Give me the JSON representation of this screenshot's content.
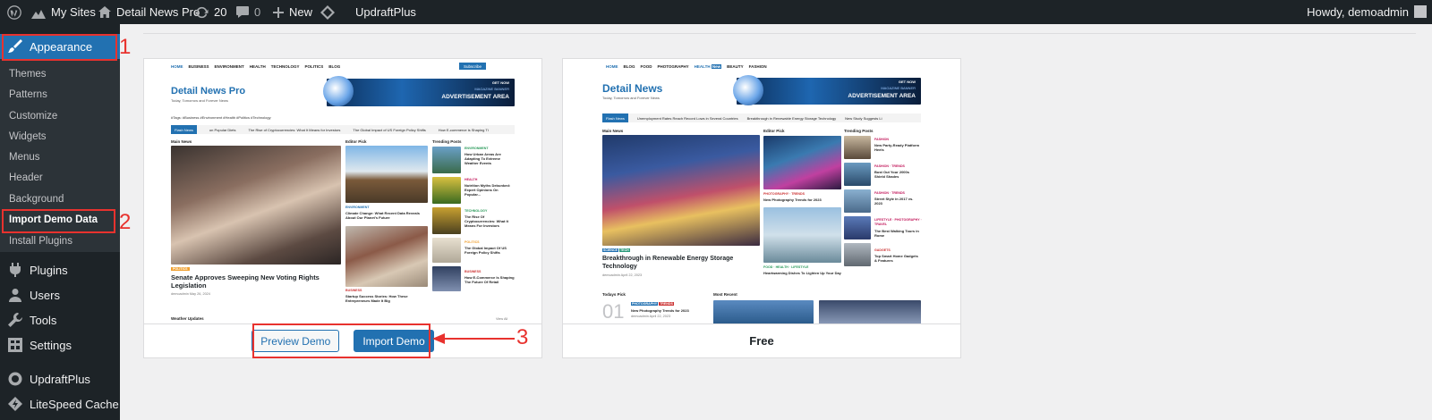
{
  "adminbar": {
    "my_sites": "My Sites",
    "site_name": "Detail News Pro",
    "updates": "20",
    "comments": "0",
    "new": "New",
    "plugin": "UpdraftPlus",
    "howdy": "Howdy, demoadmin"
  },
  "sidebar": {
    "appearance": "Appearance",
    "submenu": [
      "Themes",
      "Patterns",
      "Customize",
      "Widgets",
      "Menus",
      "Header",
      "Background",
      "Import Demo Data",
      "Install Plugins"
    ],
    "plugins": "Plugins",
    "users": "Users",
    "tools": "Tools",
    "settings": "Settings",
    "updraftplus": "UpdraftPlus",
    "litespeed": "LiteSpeed Cache"
  },
  "demos": [
    {
      "site_title": "Detail News Pro",
      "tagline": "Today, Tomorrow and Forever News",
      "nav": [
        "HOME",
        "BUSINESS",
        "ENVIRONMENT",
        "HEALTH",
        "TECHNOLOGY",
        "POLITICS",
        "BLOG"
      ],
      "subscribe": "Subscribe",
      "ad_top": "GET NOW",
      "ad_sub": "MAGAZINE BANNER",
      "ad_text": "ADVERTISEMENT AREA",
      "tags": "#Tags: #Business #Environment #Health #Politics #Technology",
      "flash_label": "Flash News",
      "flash_items": [
        "on Popular Diets",
        "The Rise of Cryptocurrencies: What It Means for Investors",
        "The Global Impact of US Foreign Policy Shifts",
        "How E-commerce is Shaping Ti"
      ],
      "main_news": "Main News",
      "editor_pick": "Editor Pick",
      "trending": "Trending Posts",
      "main_cat": "POLITICS",
      "main_title": "Senate Approves Sweeping New Voting Rights Legislation",
      "main_meta": "demoadmin  May 26, 2024",
      "ep1_cat": "ENVIRONMENT",
      "ep1_title": "Climate Change: What Recent Data Reveals About Our Planet's Future",
      "ep2_cat": "BUSINESS",
      "ep2_title": "Startup Success Stories: How These Entrepreneurs Made It Big",
      "trending_items": [
        {
          "cat": "ENVIRONMENT",
          "title": "How Urban Areas Are Adapting To Extreme Weather Events"
        },
        {
          "cat": "HEALTH",
          "title": "Nutrition Myths Debunked: Expert Opinions On Popular..."
        },
        {
          "cat": "TECHNOLOGY",
          "title": "The Rise Of Cryptocurrencies: What It Means For Investors"
        },
        {
          "cat": "POLITICS",
          "title": "The Global Impact Of US Foreign Policy Shifts"
        },
        {
          "cat": "BUSINESS",
          "title": "How E-Commerce Is Shaping The Future Of Retail"
        }
      ],
      "weather": "Weather Updates",
      "view_all": "View All",
      "preview_button": "Preview Demo",
      "import_button": "Import Demo"
    },
    {
      "site_title": "Detail News",
      "tagline": "Today, Tomorrow and Forever News",
      "nav": [
        "HOME",
        "BLOG",
        "FOOD",
        "PHOTOGRAPHY",
        "HEALTH",
        "BEAUTY",
        "FASHION"
      ],
      "nav_badge": "New",
      "ad_top": "GET NOW",
      "ad_sub": "MAGAZINE BANNER",
      "ad_text": "ADVERTISEMENT AREA",
      "flash_label": "Flash News",
      "flash_items": [
        "Unemployment Rates Reach Record Lows in Several Countries",
        "Breakthrough in Renewable Energy Storage Technology",
        "New Study Suggests Li"
      ],
      "main_news": "Main News",
      "editor_pick": "Editor Pick",
      "trending": "Trending Posts",
      "main_cats": [
        "SCIENCE",
        "TECH"
      ],
      "main_title": "Breakthrough in Renewable Energy Storage Technology",
      "main_meta": "demoadmin  April 22, 2023",
      "ep1_cat": "PHOTOGRAPHY · TRENDS",
      "ep1_title": "New Photography Trends for 2023",
      "ep2_cat": "FOOD · HEALTH · LIFESTYLE",
      "ep2_title": "Heartwarming Dishes To Lighten Up Your Day",
      "trending_items": [
        {
          "cat": "FASHION",
          "title": "New Party-Ready Platform Heels"
        },
        {
          "cat": "FASHION · TRENDS",
          "title": "Bust Out Your 2000s Shield Shades"
        },
        {
          "cat": "FASHION · TRENDS",
          "title": "Street Style in 2017 vs. 2023"
        },
        {
          "cat": "LIFESTYLE · PHOTOGRAPHY · TRAVEL",
          "title": "The Best Walking Tours in Rome"
        },
        {
          "cat": "GADGETS",
          "title": "Top Smart Home Gadgets & Features"
        }
      ],
      "todays_pick": "Todays Pick",
      "most_recent": "Most Recent",
      "pick_number": "01",
      "pick_cats": [
        "PHOTOGRAPHY",
        "TRENDS"
      ],
      "pick_title": "New Photography Trends for 2023",
      "pick_meta": "demoadmin  April 22, 2023",
      "status": "Free"
    }
  ],
  "annotations": [
    "1",
    "2",
    "3"
  ],
  "colors": {
    "accent": "#2271b1",
    "annotation": "#e8322e",
    "adminbar": "#1d2327"
  }
}
